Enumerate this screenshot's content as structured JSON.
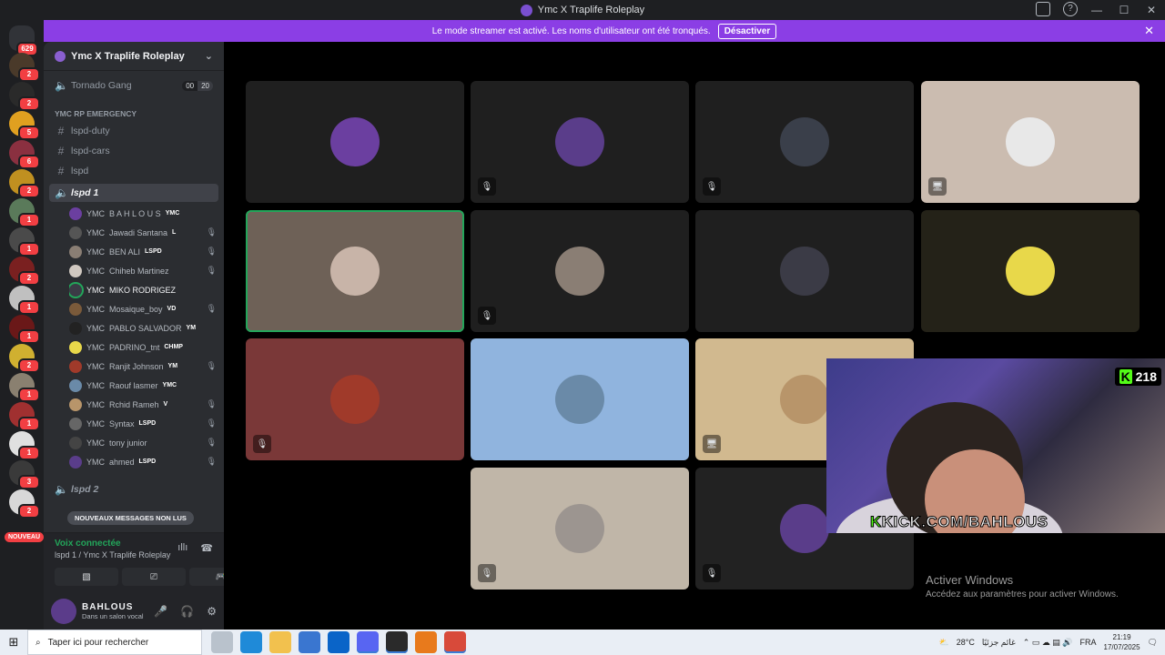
{
  "window": {
    "title": "Ymc X Traplife Roleplay",
    "controls": [
      "—",
      "☐",
      "✕"
    ]
  },
  "banner": {
    "text": "Le mode streamer est activé. Les noms d'utilisateur ont été tronqués.",
    "button": "Désactiver"
  },
  "servers": {
    "home_badge": "629",
    "badges": [
      "2",
      "2",
      "5",
      "6",
      "2",
      "1",
      "1",
      "2",
      "1",
      "1",
      "2",
      "1",
      "1",
      "1",
      "3",
      "2"
    ],
    "new_label": "NOUVEAU"
  },
  "sidebar": {
    "server_name": "Ymc X Traplife Roleplay",
    "channels": [
      {
        "name": "Tornado Gang",
        "icon": "speaker-icon",
        "count_a": "00",
        "count_b": "20"
      },
      {
        "category": "YMC RP EMERGENCY"
      },
      {
        "name": "lspd-duty",
        "icon": "hash-icon"
      },
      {
        "name": "lspd-cars",
        "icon": "hash-icon"
      },
      {
        "name": "lspd",
        "icon": "hash-icon"
      },
      {
        "name": "lspd 1",
        "icon": "speaker-icon",
        "active": true
      },
      {
        "name": "lspd 2",
        "icon": "speaker-icon"
      }
    ],
    "members": [
      {
        "prefix": "YMC",
        "name": "B A H L O U S",
        "tag": "YMC",
        "muted": false
      },
      {
        "prefix": "YMC",
        "name": "Jawadi Santana",
        "tag": "L",
        "muted": true
      },
      {
        "prefix": "YMC",
        "name": "BEN ALI",
        "tag": "LSPD",
        "muted": true
      },
      {
        "prefix": "YMC",
        "name": "Chiheb Martinez",
        "tag": "",
        "muted": true
      },
      {
        "prefix": "YMC",
        "name": "MIKO RODRIGEZ",
        "tag": "",
        "muted": false
      },
      {
        "prefix": "YMC",
        "name": "Mosaique_boy",
        "tag": "VD",
        "muted": true
      },
      {
        "prefix": "YMC",
        "name": "PABLO SALVADOR",
        "tag": "YM",
        "muted": false
      },
      {
        "prefix": "YMC",
        "name": "PADRINO_tnt",
        "tag": "CHMP",
        "muted": false
      },
      {
        "prefix": "YMC",
        "name": "Ranjit Johnson",
        "tag": "YM",
        "muted": true
      },
      {
        "prefix": "YMC",
        "name": "Raouf lasmer",
        "tag": "YMC",
        "muted": false
      },
      {
        "prefix": "YMC",
        "name": "Rchid Rameh",
        "tag": "V",
        "muted": true
      },
      {
        "prefix": "YMC",
        "name": "Syntax",
        "tag": "LSPD",
        "muted": true
      },
      {
        "prefix": "YMC",
        "name": "tony junior",
        "tag": "",
        "muted": true
      },
      {
        "prefix": "YMC",
        "name": "ahmed",
        "tag": "LSPD",
        "muted": true
      }
    ],
    "new_messages": "NOUVEAUX MESSAGES NON LUS"
  },
  "voice": {
    "status": "Voix connectée",
    "channel": "lspd 1 / Ymc X Traplife Roleplay"
  },
  "user": {
    "name": "BAHLOUS",
    "status": "Dans un salon vocal"
  },
  "stage": {
    "tiles": [
      {
        "bg": "#1f1f1f",
        "avatar": "#6b3fa0",
        "mute": ""
      },
      {
        "bg": "#1f1f1f",
        "avatar": "#5a3d8a",
        "mute": "🎙"
      },
      {
        "bg": "#1f1f1f",
        "avatar": "#3a3f4a",
        "mute": "🎙"
      },
      {
        "bg": "#cbbcb0",
        "avatar": "#e8e8e8",
        "mute": "🖥"
      },
      {
        "bg": "#6e6157",
        "avatar": "#c8b4a8",
        "mute": "",
        "speaking": true
      },
      {
        "bg": "#1f1f1f",
        "avatar": "#8a7e74",
        "mute": "🎙"
      },
      {
        "bg": "#1f1f1f",
        "avatar": "#3b3b46",
        "mute": ""
      },
      {
        "bg": "#242218",
        "avatar": "#e8d84a",
        "mute": ""
      },
      {
        "bg": "#7a3838",
        "avatar": "#a03a2a",
        "mute": "🎙"
      },
      {
        "bg": "#90b4de",
        "avatar": "#6a8aa8",
        "mute": ""
      },
      {
        "bg": "#d1b98f",
        "avatar": "#b8956a",
        "mute": "🖥"
      },
      {
        "bg": "#c0b6a8",
        "avatar": "#9c9590",
        "mute": "🎙"
      },
      {
        "bg": "#222222",
        "avatar": "#5a3d8a",
        "mute": "🎙"
      }
    ]
  },
  "overlay": {
    "kick_prefix": "K",
    "kick_text": "KICK.COM/BAHLOUS",
    "viewers_icon": "K",
    "viewers": "218"
  },
  "watermark": {
    "title": "Activer Windows",
    "subtitle": "Accédez aux paramètres pour activer Windows."
  },
  "taskbar": {
    "search_placeholder": "Taper ici pour rechercher",
    "weather": "28°C",
    "weather_text": "غائم جزئيًا",
    "lang": "FRA",
    "time": "21:19",
    "date": "17/07/2025"
  }
}
